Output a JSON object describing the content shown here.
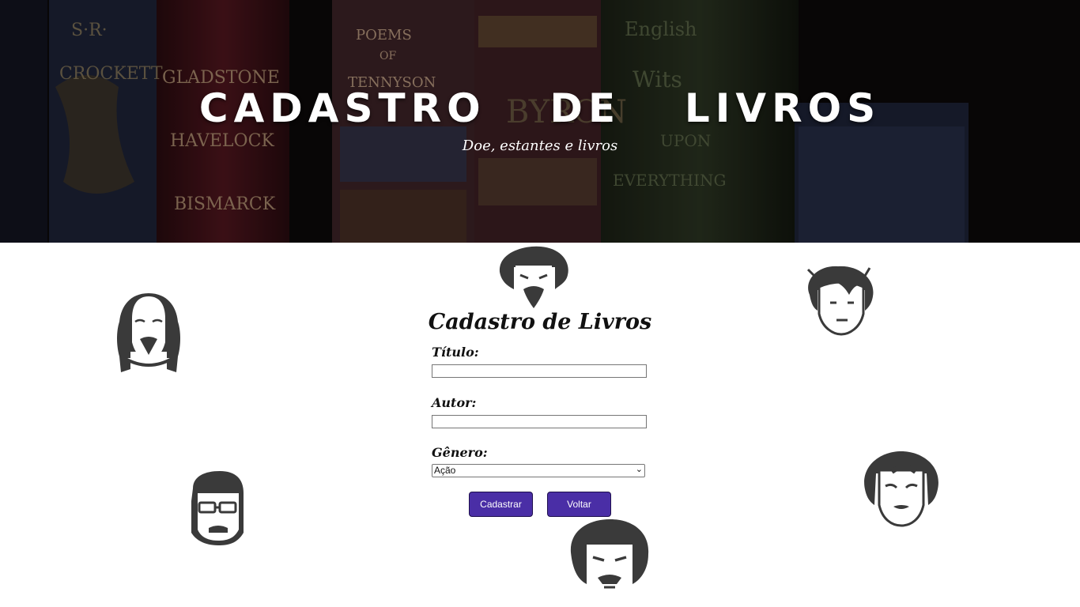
{
  "hero": {
    "title": "CADASTRO  DE  LIVROS",
    "subtitle": "Doe, estantes e livros",
    "book_spines": [
      {
        "lines": [
          "S·R·",
          "CROCKETT"
        ]
      },
      {
        "lines": [
          "GLADSTONE",
          "HAVELOCK",
          "BISMARCK"
        ]
      },
      {
        "lines": [
          "POEMS",
          "OF",
          "TENNYSON"
        ]
      },
      {
        "lines": [
          "BYRON"
        ]
      },
      {
        "lines": [
          "English",
          "Wits",
          "UPON",
          "EVERYTHING"
        ]
      }
    ]
  },
  "form": {
    "title": "Cadastro de Livros",
    "titulo_label": "Título:",
    "titulo_value": "",
    "autor_label": "Autor:",
    "autor_value": "",
    "genero_label": "Gênero:",
    "genero_selected": "Ação",
    "cadastrar_label": "Cadastrar",
    "voltar_label": "Voltar"
  },
  "colors": {
    "button_bg": "#4a2ea6",
    "face_fill": "#3a3a3a",
    "hero_bg": "#0d0a0b"
  },
  "icons": [
    "shakespeare-face-icon",
    "cervantes-face-icon",
    "young-author-face-icon",
    "stephen-king-face-icon",
    "edgar-allan-poe-face-icon",
    "oscar-wilde-face-icon"
  ]
}
